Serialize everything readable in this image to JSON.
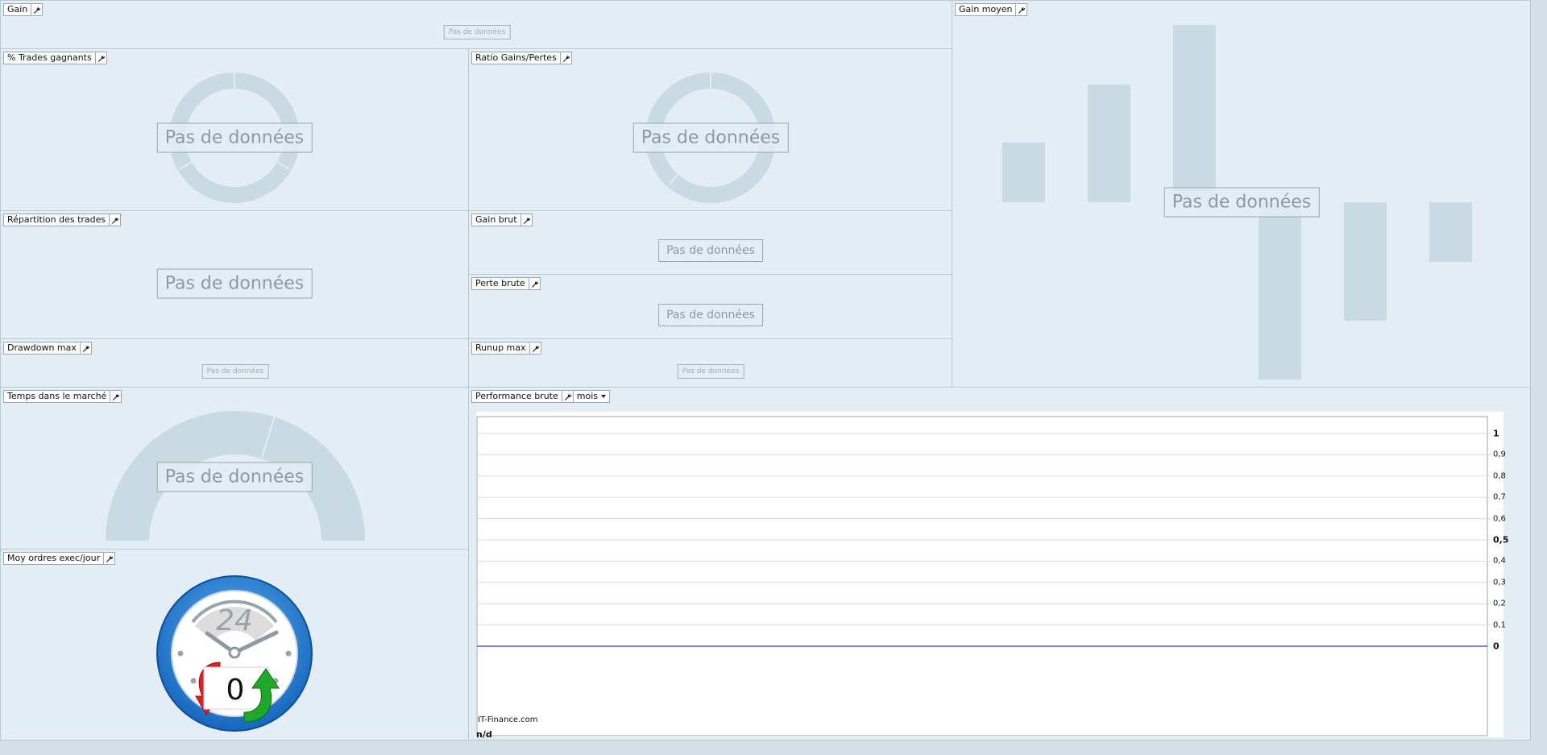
{
  "common": {
    "no_data": "Pas de données"
  },
  "panels": {
    "gain": "Gain",
    "gain_moyen": "Gain moyen",
    "trades_gagnants": "% Trades gagnants",
    "ratio_gains_pertes": "Ratio Gains/Pertes",
    "repartition_trades": "Répartition des trades",
    "gain_brut": "Gain brut",
    "perte_brute": "Perte brute",
    "drawdown_max": "Drawdown max",
    "runup_max": "Runup max",
    "temps_marche": "Temps dans le marché",
    "moy_ordres": "Moy ordres exec/jour",
    "performance_brute": "Performance brute"
  },
  "performance": {
    "period_select": "mois",
    "watermark": "IT-Finance.com",
    "footer_value": "n/d",
    "y_ticks": [
      "1",
      "0,9",
      "0,8",
      "0,7",
      "0,6",
      "0,5",
      "0,4",
      "0,3",
      "0,2",
      "0,1",
      "0"
    ],
    "y_bold": [
      "1",
      "0,5",
      "0"
    ]
  },
  "clock_widget": {
    "icon": "clock-24-exchange-icon",
    "label": "24",
    "value": "0"
  },
  "colors": {
    "panel_bg": "#e3edf3",
    "placeholder_fill": "#c8dbe3",
    "zero_line": "#3a3ab0",
    "clock_ring": "#2a84d8",
    "arrow_red": "#e02020",
    "arrow_green": "#1fa82a"
  }
}
